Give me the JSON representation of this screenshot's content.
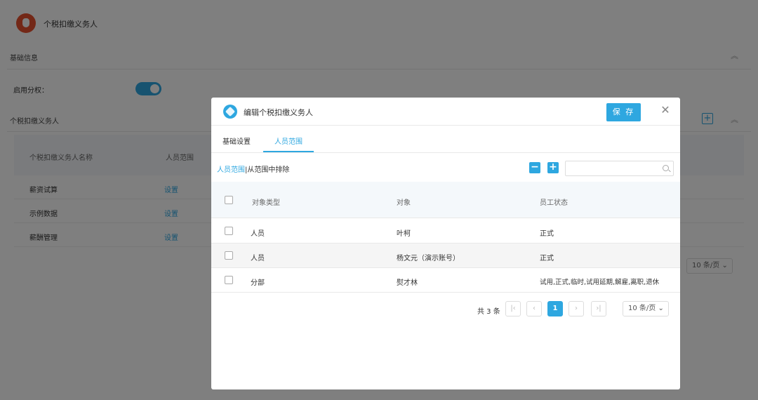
{
  "background": {
    "app_title": "个税扣缴义务人",
    "basic_section": "基础信息",
    "toggle_label": "启用分权：",
    "toggle_on": true,
    "list_section": "个税扣缴义务人",
    "table_headers": [
      "个税扣缴义务人名称",
      "人员范围"
    ],
    "rows": [
      {
        "name": "薪资试算",
        "action": "设置"
      },
      {
        "name": "示例数据",
        "action": "设置"
      },
      {
        "name": "薪酬管理",
        "action": "设置"
      }
    ],
    "page_size": "10 条/页",
    "icons": {
      "collapse": "chevron-up-icon",
      "add": "plus-icon",
      "logo": "money-bag-icon"
    }
  },
  "modal": {
    "title": "编辑个税扣缴义务人",
    "save_label": "保 存",
    "close_icon": "close-icon",
    "tabs": [
      {
        "label": "基础设置",
        "active": false
      },
      {
        "label": "人员范围",
        "active": true
      }
    ],
    "scope_link": "人员范围",
    "exclude_link": "从范围中排除",
    "search": {
      "value": "",
      "placeholder": ""
    },
    "table": {
      "headers": [
        "对象类型",
        "对象",
        "员工状态"
      ],
      "rows": [
        {
          "type": "人员",
          "object": "叶柯",
          "status": "正式"
        },
        {
          "type": "人员",
          "object": "杨文元（演示账号）",
          "status": "正式"
        },
        {
          "type": "分部",
          "object": "熨才林",
          "status": "试用,正式,临时,试用延期,解雇,离职,退休"
        }
      ]
    },
    "pagination": {
      "total": "共 3 条",
      "current_page": "1",
      "page_size": "10 条/页"
    }
  },
  "colors": {
    "accent": "#2ea7e0",
    "logo": "#e7512f",
    "overlay": "rgba(0,0,0,0.5)"
  }
}
